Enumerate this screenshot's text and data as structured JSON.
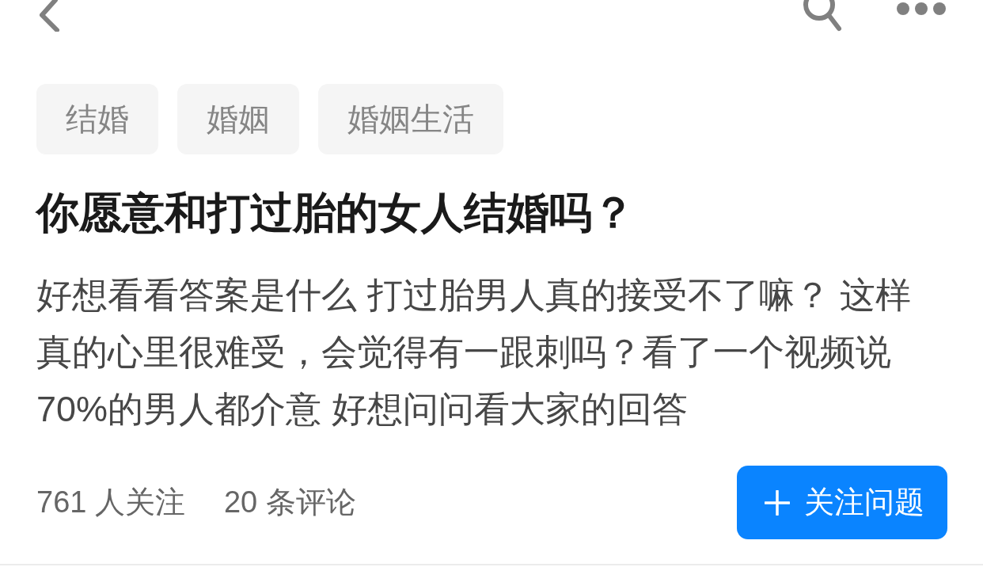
{
  "tags": [
    "结婚",
    "婚姻",
    "婚姻生活"
  ],
  "question": {
    "title": "你愿意和打过胎的女人结婚吗？",
    "description": "好想看看答案是什么 打过胎男人真的接受不了嘛？ 这样真的心里很难受，会觉得有一跟刺吗？看了一个视频说70%的男人都介意 好想问问看大家的回答"
  },
  "stats": {
    "followers": "761 人关注",
    "comments": "20 条评论"
  },
  "follow_button": {
    "label": "关注问题"
  }
}
